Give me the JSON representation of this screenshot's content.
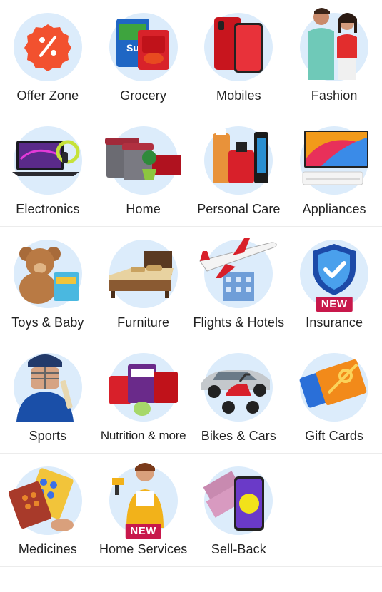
{
  "categories": [
    {
      "label": "Offer Zone",
      "icon": "offer-percent-icon"
    },
    {
      "label": "Grocery",
      "icon": "grocery-icon"
    },
    {
      "label": "Mobiles",
      "icon": "mobiles-icon"
    },
    {
      "label": "Fashion",
      "icon": "fashion-icon"
    },
    {
      "label": "Electronics",
      "icon": "laptop-icon"
    },
    {
      "label": "Home",
      "icon": "home-icon"
    },
    {
      "label": "Personal Care",
      "icon": "personal-care-icon"
    },
    {
      "label": "Appliances",
      "icon": "tv-icon"
    },
    {
      "label": "Toys & Baby",
      "icon": "teddy-bear-icon"
    },
    {
      "label": "Furniture",
      "icon": "bed-icon"
    },
    {
      "label": "Flights & Hotels",
      "icon": "airplane-icon"
    },
    {
      "label": "Insurance",
      "icon": "shield-icon",
      "badge": "NEW"
    },
    {
      "label": "Sports",
      "icon": "cricket-icon"
    },
    {
      "label": "Nutrition & more",
      "icon": "nutrition-icon"
    },
    {
      "label": "Bikes & Cars",
      "icon": "vehicle-icon"
    },
    {
      "label": "Gift Cards",
      "icon": "gift-card-icon"
    },
    {
      "label": "Medicines",
      "icon": "pills-icon"
    },
    {
      "label": "Home Services",
      "icon": "drill-worker-icon",
      "badge": "NEW"
    },
    {
      "label": "Sell-Back",
      "icon": "sell-back-phone-icon"
    }
  ],
  "colors": {
    "circle_bg": "#dcecfb",
    "badge_bg": "#c8184b",
    "offer_orange": "#f2512f"
  }
}
